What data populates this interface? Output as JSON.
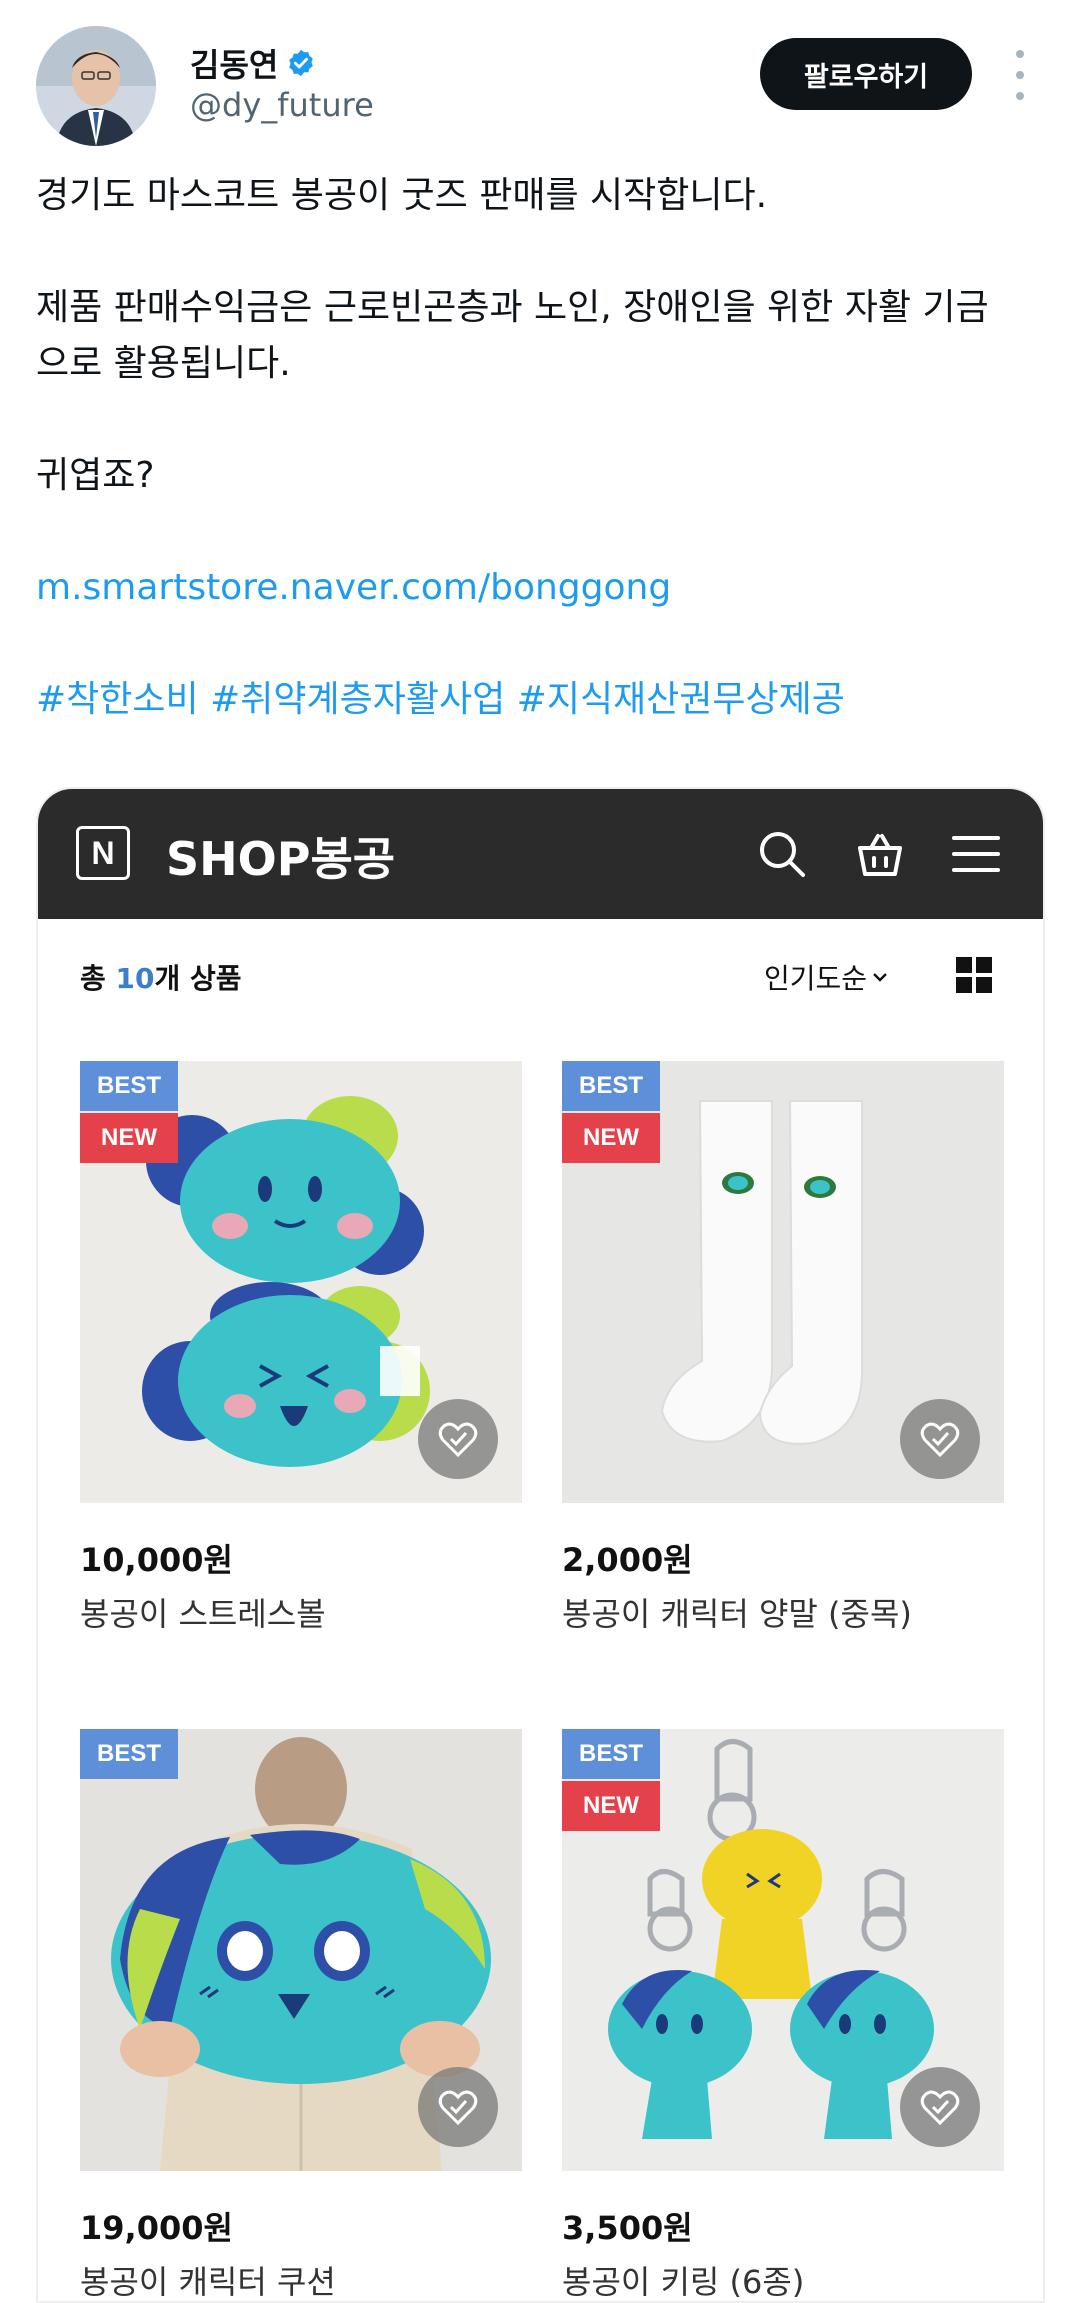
{
  "tweet": {
    "author_name": "김동연",
    "handle": "@dy_future",
    "follow_label": "팔로우하기",
    "lines": [
      "경기도 마스코트 봉공이 굿즈 판매를 시작합니다.",
      "제품 판매수익금은 근로빈곤층과 노인, 장애인을 위한 자활 기금",
      "으로 활용됩니다.",
      "귀엽죠?"
    ],
    "link": "m.smartstore.naver.com/bonggong",
    "hashtags": "#착한소비 #취약계층자활사업 #지식재산권무상제공"
  },
  "shop": {
    "logo_letter": "N",
    "title": "SHOP봉공",
    "count_prefix": "총 ",
    "count_num": "10",
    "count_suffix": "개 상품",
    "sort_label": "인기도순",
    "products": [
      {
        "best": "BEST",
        "new": "NEW",
        "price": "10,000원",
        "name": "봉공이 스트레스볼"
      },
      {
        "best": "BEST",
        "new": "NEW",
        "price": "2,000원",
        "name": "봉공이 캐릭터 양말 (중목)"
      },
      {
        "best": "BEST",
        "new": "",
        "price": "19,000원",
        "name": "봉공이 캐릭터 쿠션"
      },
      {
        "best": "BEST",
        "new": "NEW",
        "price": "3,500원",
        "name": "봉공이 키링 (6종)"
      }
    ]
  },
  "colors": {
    "link": "#1d9bf0",
    "verified": "#1d9bf0",
    "shop_bar": "#2b2b2b",
    "badge_best": "#5e8fd9",
    "badge_new": "#e4414b"
  },
  "icons": [
    "verified-badge-icon",
    "more-options-icon",
    "naver-logo-icon",
    "search-icon",
    "bag-icon",
    "menu-icon",
    "chevron-down-icon",
    "grid-view-icon",
    "wishlist-icon"
  ]
}
